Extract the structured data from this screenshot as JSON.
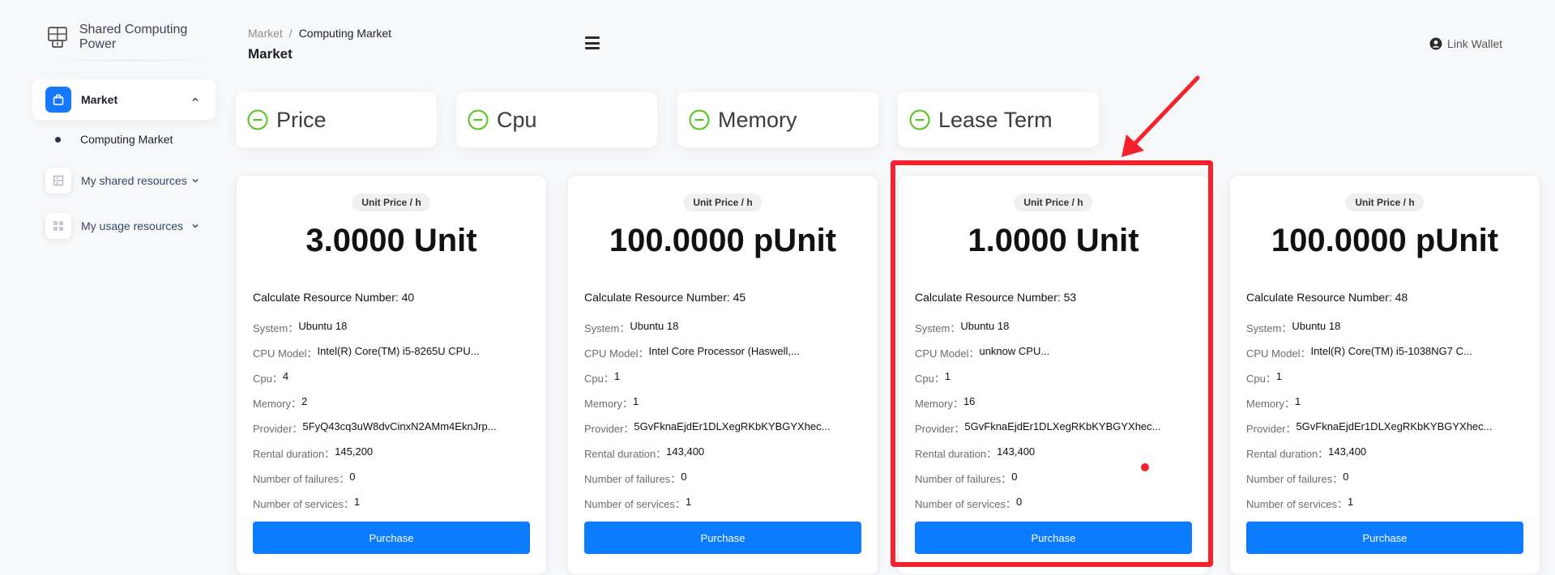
{
  "brand": {
    "name": "Shared Computing Power"
  },
  "sidebar": {
    "items": [
      {
        "label": "Market"
      },
      {
        "label": "My shared resources"
      },
      {
        "label": "My usage resources"
      }
    ],
    "sub_items": [
      {
        "label": "Computing Market"
      }
    ]
  },
  "header": {
    "breadcrumb": {
      "parent": "Market",
      "separator": "/",
      "current": "Computing Market"
    },
    "title": "Market",
    "wallet_label": "Link Wallet"
  },
  "filters": [
    {
      "label": "Price"
    },
    {
      "label": "Cpu"
    },
    {
      "label": "Memory"
    },
    {
      "label": "Lease Term"
    }
  ],
  "cards": [
    {
      "price_tag": "Unit Price / h",
      "price": "3.0000 Unit",
      "crn": "Calculate Resource Number: 40",
      "system": "Ubuntu 18",
      "cpu_model": "Intel(R) Core(TM) i5-8265U CPU...",
      "cpu": "4",
      "memory": "2",
      "provider": "5FyQ43cq3uW8dvCinxN2AMm4EknJrp...",
      "rental_duration": "145,200",
      "failures": "0",
      "services": "1",
      "button": "Purchase"
    },
    {
      "price_tag": "Unit Price / h",
      "price": "100.0000 pUnit",
      "crn": "Calculate Resource Number: 45",
      "system": "Ubuntu 18",
      "cpu_model": "Intel Core Processor (Haswell,...",
      "cpu": "1",
      "memory": "1",
      "provider": "5GvFknaEjdEr1DLXegRKbKYBGYXhec...",
      "rental_duration": "143,400",
      "failures": "0",
      "services": "1",
      "button": "Purchase"
    },
    {
      "price_tag": "Unit Price / h",
      "price": "1.0000 Unit",
      "crn": "Calculate Resource Number: 53",
      "system": "Ubuntu 18",
      "cpu_model": "unknow CPU...",
      "cpu": "1",
      "memory": "16",
      "provider": "5GvFknaEjdEr1DLXegRKbKYBGYXhec...",
      "rental_duration": "143,400",
      "failures": "0",
      "services": "0",
      "button": "Purchase"
    },
    {
      "price_tag": "Unit Price / h",
      "price": "100.0000 pUnit",
      "crn": "Calculate Resource Number: 48",
      "system": "Ubuntu 18",
      "cpu_model": "Intel(R) Core(TM) i5-1038NG7 C...",
      "cpu": "1",
      "memory": "1",
      "provider": "5GvFknaEjdEr1DLXegRKbKYBGYXhec...",
      "rental_duration": "143,400",
      "failures": "0",
      "services": "1",
      "button": "Purchase"
    }
  ],
  "spec_labels": {
    "system": "System：",
    "cpu_model": "CPU Model：",
    "cpu": "Cpu：",
    "memory": "Memory：",
    "provider": "Provider：",
    "rental_duration": "Rental duration：",
    "failures": "Number of failures：",
    "services": "Number of services："
  },
  "colors": {
    "accent": "#1677ff",
    "button": "#0b7cff",
    "filter_icon": "#52c41a",
    "highlight": "#f5222d"
  }
}
